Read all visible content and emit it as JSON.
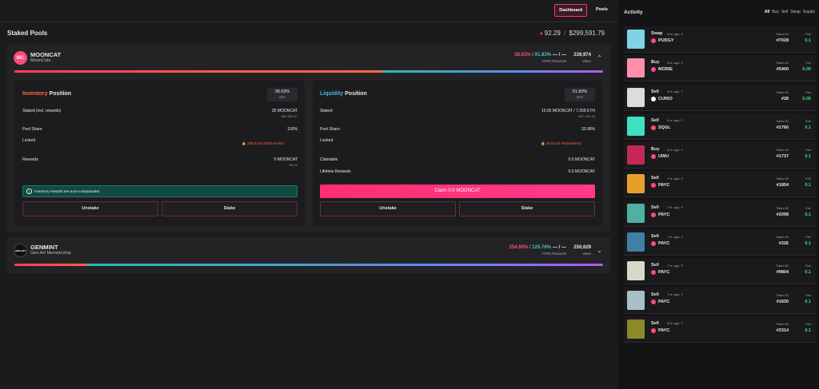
{
  "nav": {
    "dashboard": "Dashboard",
    "pools": "Pools"
  },
  "page": {
    "title": "Staked Pools",
    "total_eth": "92.29",
    "total_sep": "/",
    "total_usd": "$299,591.79"
  },
  "pool1": {
    "logo_text": "MC",
    "name": "MOONCAT",
    "subtitle": "MoonCats",
    "apr_red": "38.63%",
    "apr_teal": "91.83%",
    "apr_label": "APRs",
    "rewards": "— / —",
    "rewards_label": "Rewards",
    "value": "239,974",
    "value_label": "Value",
    "inventory": {
      "title_a": "Inventory",
      "title_b": "Position",
      "apr_value": "38.63%",
      "apr_label": "APR",
      "staked_label": "Staked (incl. rewards)",
      "staked_value": "35 MOONCAT",
      "staked_sub": "~$82,580.97",
      "share_label": "Pool Share",
      "share_value": "100%",
      "locked_label": "Locked",
      "locked_value": "🔒 288:52:54 REMAINING",
      "rewards_label": "Rewards",
      "rewards_value": "0 MOONCAT",
      "rewards_sub": "~$0.00",
      "notice": "Inventory rewards are auto-compounded.",
      "unstake": "Unstake",
      "stake": "Stake"
    },
    "liquidity": {
      "title_a": "Liquidity",
      "title_b": "Position",
      "apr_value": "91.83%",
      "apr_label": "APR",
      "staked_label": "Staked",
      "staked_value": "10.00 MOONCAT / 7.268 ETH",
      "staked_sub": "~$47,189.28",
      "share_label": "Pool Share",
      "share_value": "33.96%",
      "locked_label": "Locked",
      "locked_value": "🔒 48:54:00 REMAINING",
      "claimable_label": "Claimable",
      "claimable_value": "0.0 MOONCAT",
      "lifetime_label": "Lifetime Rewards",
      "lifetime_value": "0.0 MOONCAT",
      "claim": "Claim 0.0 MOONCAT",
      "unstake": "Unstake",
      "stake": "Stake"
    }
  },
  "pool2": {
    "logo_text": "GEN.ART",
    "name": "GENMINT",
    "subtitle": "Gen.Art Membership",
    "apr_red": "254.80%",
    "apr_teal": "125.76%",
    "apr_label": "APRs",
    "rewards": "— / —",
    "rewards_label": "Rewards",
    "value": "250,629",
    "value_label": "Value"
  },
  "activity": {
    "title": "Activity",
    "filters": [
      "All",
      "Buy",
      "Sell",
      "Swap",
      "Supply"
    ],
    "token_label": "Token ID",
    "fee_label": "Fee",
    "items": [
      {
        "type": "Swap",
        "time": "5 hr. ago ↗",
        "collection": "PUDGY",
        "token": "#7028",
        "fee": "0.1",
        "thumb": "#7fd3e8",
        "dot": "#ff4a7d"
      },
      {
        "type": "Buy",
        "time": "5 hr. ago ↗",
        "collection": "MORIE",
        "token": "#5400",
        "fee": "0.05",
        "thumb": "#ff8fa8",
        "dot": "#ff4a7d"
      },
      {
        "type": "Sell",
        "time": "5 hr. ago ↗",
        "collection": "CURIO",
        "token": "#28",
        "fee": "0.05",
        "thumb": "#dcdcdc",
        "dot": "#ffffff"
      },
      {
        "type": "Sell",
        "time": "6 hr. ago ↗",
        "collection": "SQGL",
        "token": "#1766",
        "fee": "0.1",
        "thumb": "#3de0c0",
        "dot": "#ff4a7d"
      },
      {
        "type": "Buy",
        "time": "6 hr. ago ↗",
        "collection": "UWU",
        "token": "#1737",
        "fee": "0.1",
        "thumb": "#c42a55",
        "dot": "#ff4a7d"
      },
      {
        "type": "Sell",
        "time": "7 hr. ago ↗",
        "collection": "PAYC",
        "token": "#1854",
        "fee": "0.1",
        "thumb": "#e6a02a",
        "dot": "#ff4a7d"
      },
      {
        "type": "Sell",
        "time": "7 hr. ago ↗",
        "collection": "PAYC",
        "token": "#2098",
        "fee": "0.1",
        "thumb": "#4fb0a4",
        "dot": "#ff4a7d"
      },
      {
        "type": "Sell",
        "time": "7 hr. ago ↗",
        "collection": "PAYC",
        "token": "#326",
        "fee": "0.1",
        "thumb": "#3f7fa8",
        "dot": "#ff4a7d"
      },
      {
        "type": "Sell",
        "time": "7 hr. ago ↗",
        "collection": "PAYC",
        "token": "#9804",
        "fee": "0.1",
        "thumb": "#d8d8c8",
        "dot": "#ff4a7d"
      },
      {
        "type": "Sell",
        "time": "7 hr. ago ↗",
        "collection": "PAYC",
        "token": "#1830",
        "fee": "0.1",
        "thumb": "#a8c0c8",
        "dot": "#ff4a7d"
      },
      {
        "type": "Sell",
        "time": "8 hr. ago ↗",
        "collection": "PAYC",
        "token": "#3314",
        "fee": "0.1",
        "thumb": "#8a8a2a",
        "dot": "#ff4a7d"
      }
    ]
  }
}
